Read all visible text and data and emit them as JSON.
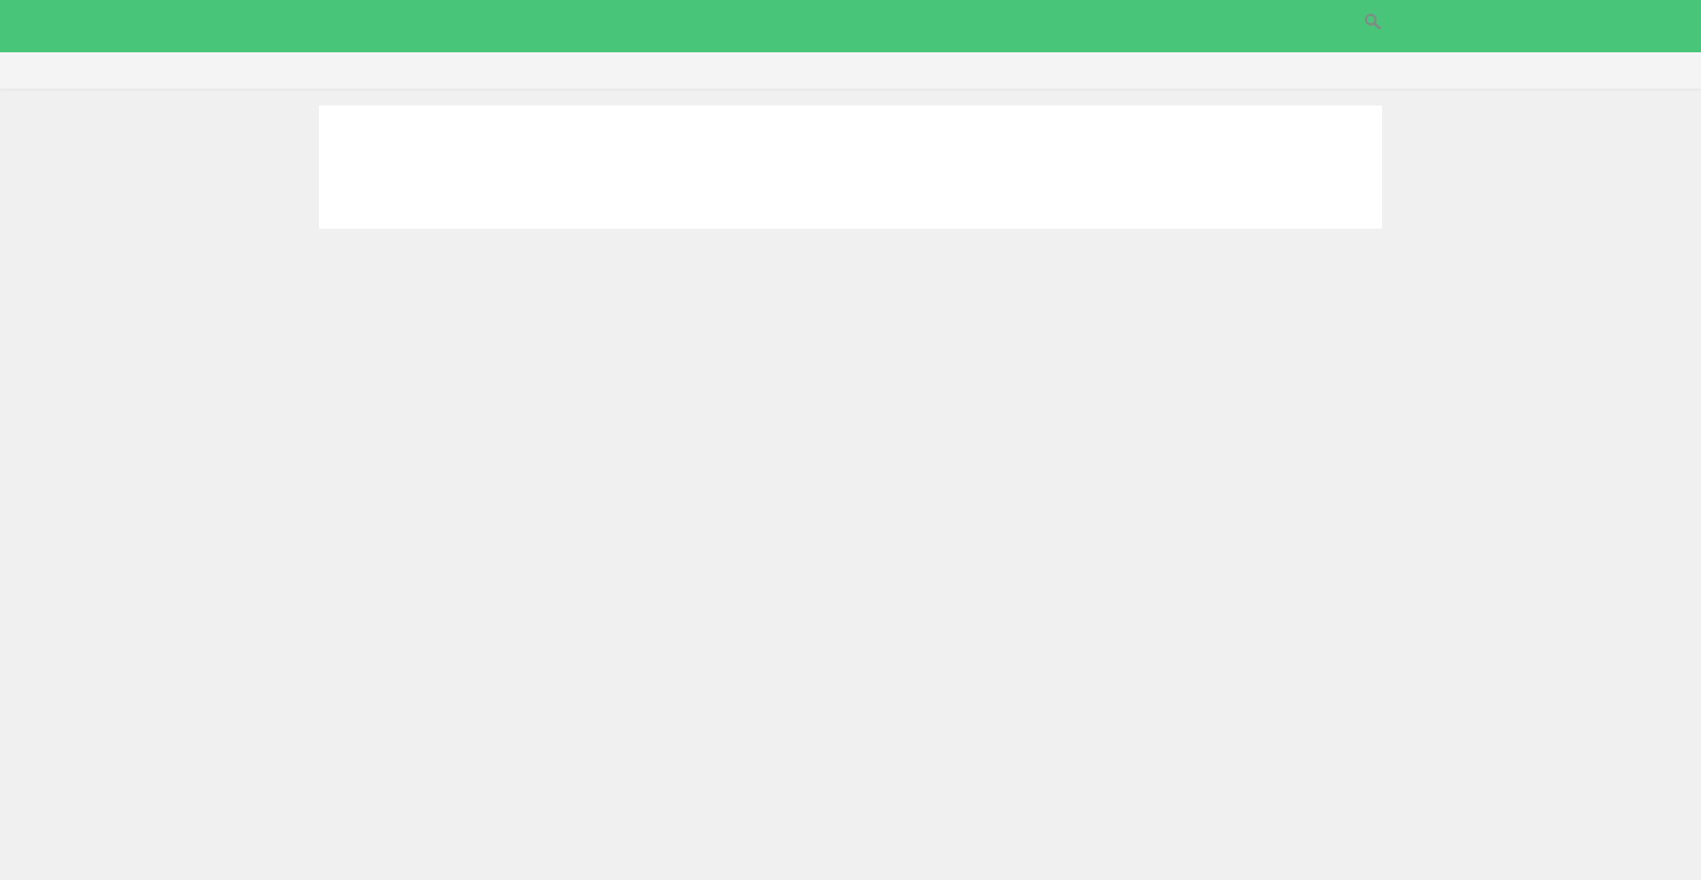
{
  "header": {
    "search_button": true
  }
}
